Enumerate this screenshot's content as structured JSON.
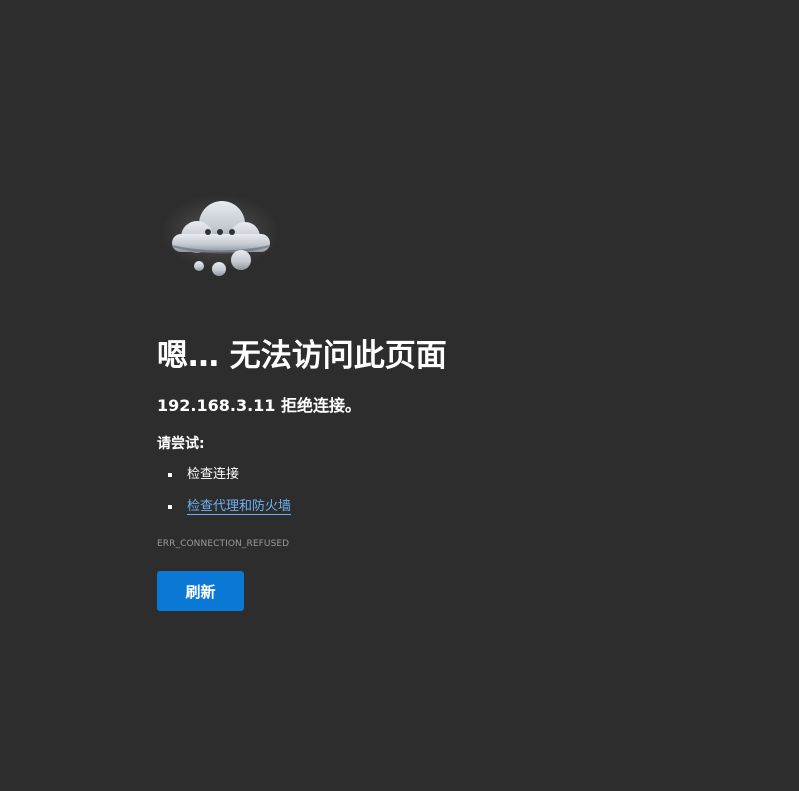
{
  "error_page": {
    "icon": "cloud-thinking-icon",
    "title": "嗯… 无法访问此页面",
    "subtitle": "192.168.3.11 拒绝连接。",
    "try_label": "请尝试:",
    "suggestions": [
      {
        "label": "检查连接",
        "is_link": false
      },
      {
        "label": "检查代理和防火墙",
        "is_link": true
      }
    ],
    "error_code": "ERR_CONNECTION_REFUSED",
    "refresh_label": "刷新"
  },
  "colors": {
    "background": "#2d2d2d",
    "text": "#ffffff",
    "link": "#6cb0f2",
    "muted": "#9a9a9a",
    "button": "#0a78d4"
  }
}
